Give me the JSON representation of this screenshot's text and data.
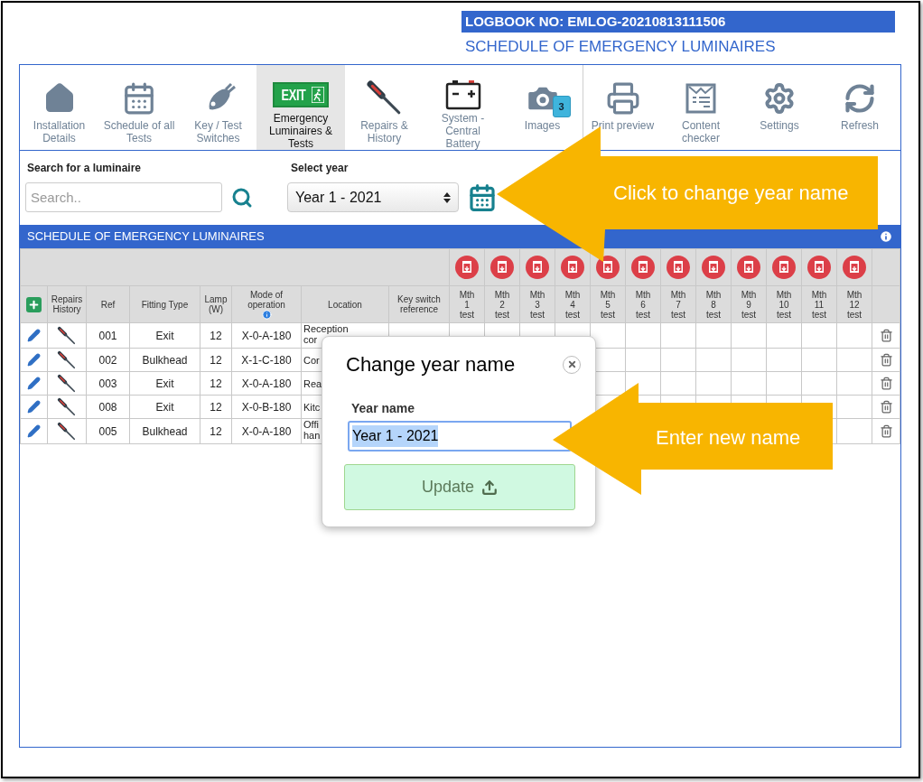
{
  "logbook": {
    "number": "LOGBOOK NO: EMLOG-20210813111506",
    "subtitle": "SCHEDULE OF EMERGENCY LUMINAIRES"
  },
  "toolbar": {
    "items": [
      {
        "label": "Installation Details",
        "selected": false
      },
      {
        "label": "Schedule of all Tests",
        "selected": false
      },
      {
        "label": "Key / Test Switches",
        "selected": false
      },
      {
        "label": "Emergency Luminaires & Tests",
        "sign_text": "EXIT",
        "selected": true
      },
      {
        "label": "Repairs & History",
        "selected": false
      },
      {
        "label": "System - Central Battery",
        "selected": false
      },
      {
        "label": "Images",
        "badge": "3",
        "selected": false
      }
    ],
    "right_items": [
      {
        "label": "Print preview"
      },
      {
        "label": "Content checker"
      },
      {
        "label": "Settings"
      },
      {
        "label": "Refresh"
      }
    ]
  },
  "search": {
    "label": "Search for a luminaire",
    "placeholder": "Search.."
  },
  "year_select": {
    "label": "Select year",
    "value": "Year 1 - 2021"
  },
  "schedule": {
    "title": "SCHEDULE OF EMERGENCY LUMINAIRES",
    "columns": [
      "Repairs History",
      "Ref",
      "Fitting Type",
      "Lamp (W)",
      "Mode of operation",
      "Location",
      "Key switch reference"
    ],
    "month_columns": [
      "Mth 1 test",
      "Mth 2 test",
      "Mth 3 test",
      "Mth 4 test",
      "Mth 5 test",
      "Mth 6 test",
      "Mth 7 test",
      "Mth 8 test",
      "Mth 9 test",
      "Mth 10 test",
      "Mth 11 test",
      "Mth 12 test"
    ],
    "rows": [
      {
        "ref": "001",
        "fitting_type": "Exit",
        "lamp": "12",
        "mode": "X-0-A-180",
        "location": "Reception cor"
      },
      {
        "ref": "002",
        "fitting_type": "Bulkhead",
        "lamp": "12",
        "mode": "X-1-C-180",
        "location": "Cor"
      },
      {
        "ref": "003",
        "fitting_type": "Exit",
        "lamp": "12",
        "mode": "X-0-A-180",
        "location": "Rea"
      },
      {
        "ref": "008",
        "fitting_type": "Exit",
        "lamp": "12",
        "mode": "X-0-B-180",
        "location": "Kitc"
      },
      {
        "ref": "005",
        "fitting_type": "Bulkhead",
        "lamp": "12",
        "mode": "X-0-A-180",
        "location": "Offi han"
      }
    ]
  },
  "dialog": {
    "title": "Change year name",
    "field_label": "Year name",
    "value": "Year 1 - 2021",
    "button": "Update"
  },
  "callouts": [
    {
      "text": "Click to change year name"
    },
    {
      "text": "Enter new name"
    }
  ]
}
